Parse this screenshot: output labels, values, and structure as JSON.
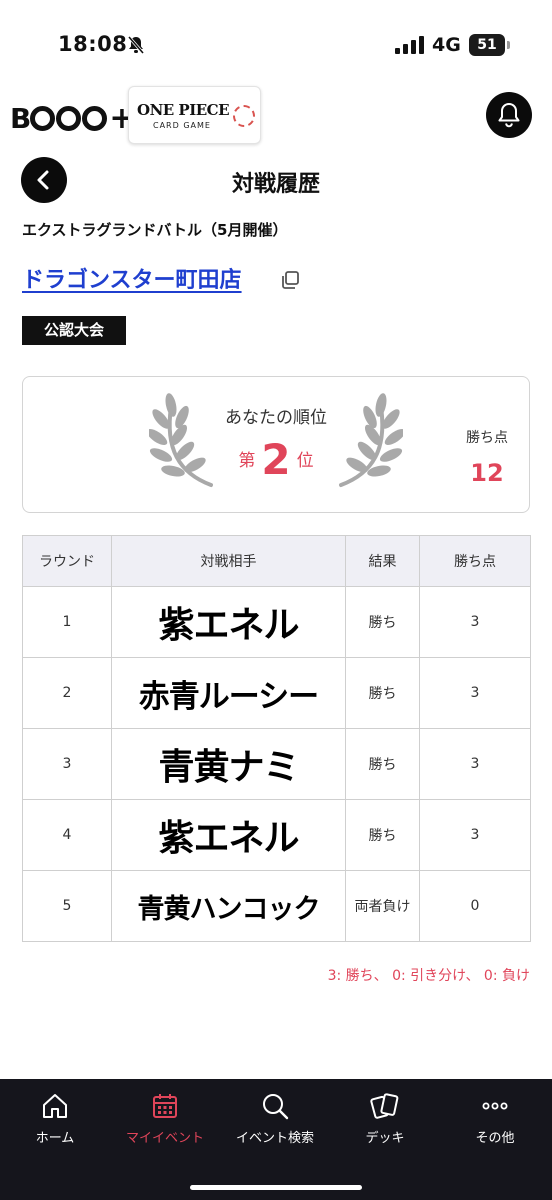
{
  "status": {
    "time": "18:08",
    "network": "4G",
    "battery": "51"
  },
  "header": {
    "brand": "B",
    "plus": "+",
    "game_title": "ONE PIECE",
    "game_sub": "CARD GAME"
  },
  "page": {
    "title": "対戦履歴",
    "event_name": "エクストラグランドバトル（5月開催）",
    "store_name": "ドラゴンスター町田店",
    "tag": "公認大会"
  },
  "ranking": {
    "label": "あなたの順位",
    "prefix": "第",
    "rank": "2",
    "suffix": "位",
    "points_label": "勝ち点",
    "points": "12"
  },
  "table": {
    "headers": [
      "ラウンド",
      "対戦相手",
      "結果",
      "勝ち点"
    ],
    "rows": [
      {
        "round": "1",
        "opponent": "紫エネル",
        "result": "勝ち",
        "points": "3"
      },
      {
        "round": "2",
        "opponent": "赤青ルーシー",
        "result": "勝ち",
        "points": "3"
      },
      {
        "round": "3",
        "opponent": "青黄ナミ",
        "result": "勝ち",
        "points": "3"
      },
      {
        "round": "4",
        "opponent": "紫エネル",
        "result": "勝ち",
        "points": "3"
      },
      {
        "round": "5",
        "opponent": "青黄ハンコック",
        "result": "両者負け",
        "points": "0"
      }
    ]
  },
  "legend": "3: 勝ち、 0: 引き分け、 0: 負け",
  "nav": {
    "items": [
      {
        "label": "ホーム",
        "icon": "home-icon"
      },
      {
        "label": "マイイベント",
        "icon": "calendar-icon",
        "active": true
      },
      {
        "label": "イベント検索",
        "icon": "search-icon"
      },
      {
        "label": "デッキ",
        "icon": "cards-icon"
      },
      {
        "label": "その他",
        "icon": "more-icon"
      }
    ]
  },
  "colors": {
    "accent": "#e0455a",
    "link": "#1f3fcf",
    "nav_bg": "#15151c"
  }
}
